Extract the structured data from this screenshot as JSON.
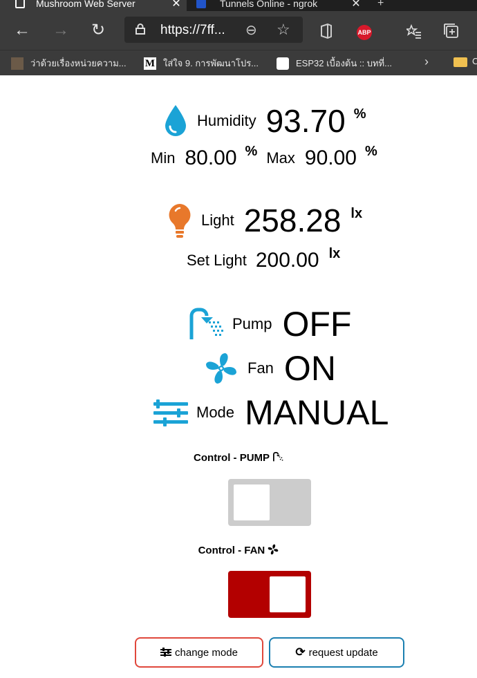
{
  "browser": {
    "tabs": [
      {
        "title": "Mushroom Web Server",
        "active": true
      },
      {
        "title": "Tunnels Online - ngrok",
        "active": false
      }
    ],
    "new_tab": "+",
    "url": "https://7ff...",
    "extension_abp": "ABP",
    "bookmarks": [
      {
        "label": "ว่าด้วยเรื่องหน่วยความ..."
      },
      {
        "label": "ใส่ใจ 9. การพัฒนาโปร..."
      },
      {
        "label": "ESP32 เบื้องต้น :: บทที่..."
      }
    ],
    "bookmarks_overflow": "C"
  },
  "humidity": {
    "label": "Humidity",
    "value": "93.70",
    "unit": "%",
    "min_label": "Min",
    "min_value": "80.00",
    "max_label": "Max",
    "max_value": "90.00"
  },
  "light": {
    "label": "Light",
    "value": "258.28",
    "unit": "lx",
    "set_label": "Set Light",
    "set_value": "200.00"
  },
  "pump": {
    "label": "Pump",
    "state": "OFF"
  },
  "fan": {
    "label": "Fan",
    "state": "ON"
  },
  "mode": {
    "label": "Mode",
    "value": "MANUAL"
  },
  "controls": {
    "pump_title": "Control - PUMP",
    "pump_on": false,
    "fan_title": "Control - FAN",
    "fan_on": true
  },
  "buttons": {
    "change_mode": "change mode",
    "request_update": "request update"
  },
  "colors": {
    "accent_blue": "#1ba3d6",
    "light_orange": "#e8782b",
    "switch_on": "#b30000",
    "switch_off": "#cccccc",
    "change_mode_border": "#e0473b",
    "request_update_border": "#1a7fb0"
  }
}
